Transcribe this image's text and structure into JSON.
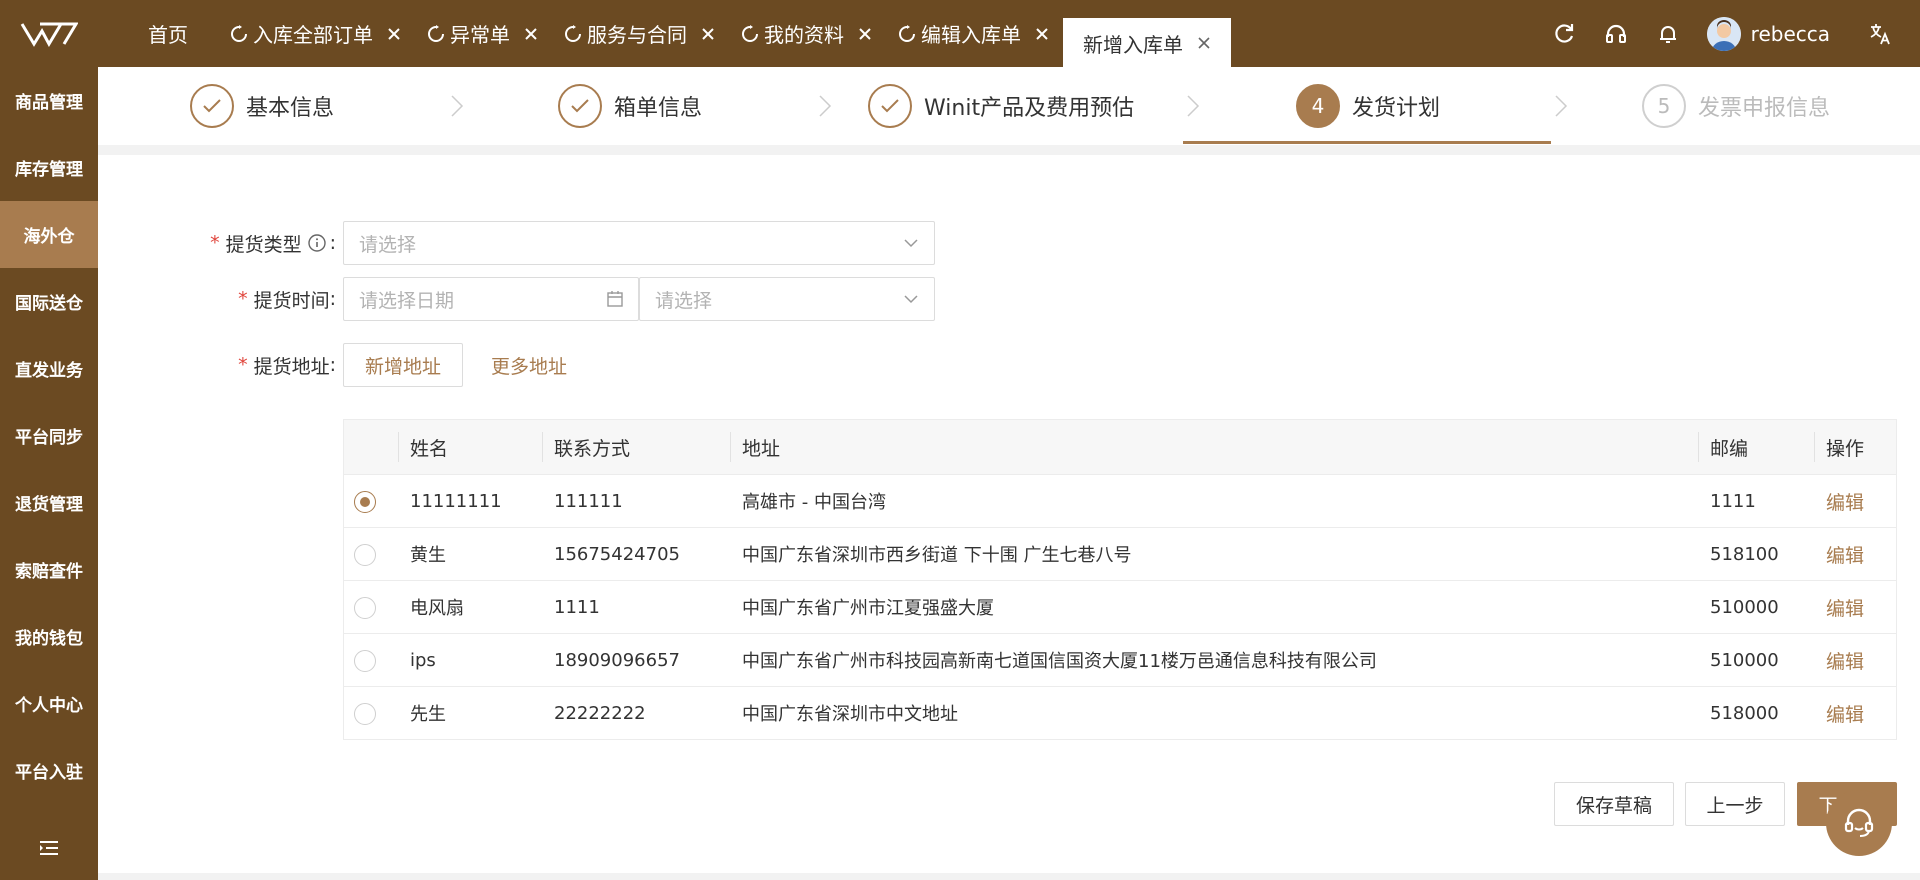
{
  "app": {
    "tabs": [
      {
        "label": "首页"
      },
      {
        "label": "入库全部订单"
      },
      {
        "label": "异常单"
      },
      {
        "label": "服务与合同"
      },
      {
        "label": "我的资料"
      },
      {
        "label": "编辑入库单"
      },
      {
        "label": "新增入库单"
      }
    ],
    "username": "rebecca"
  },
  "sidebar": {
    "items": [
      {
        "label": "商品管理"
      },
      {
        "label": "库存管理"
      },
      {
        "label": "海外仓"
      },
      {
        "label": "国际送仓"
      },
      {
        "label": "直发业务"
      },
      {
        "label": "平台同步"
      },
      {
        "label": "退货管理"
      },
      {
        "label": "索赔查件"
      },
      {
        "label": "我的钱包"
      },
      {
        "label": "个人中心"
      },
      {
        "label": "平台入驻"
      }
    ],
    "active_index": 2
  },
  "steps": [
    {
      "label": "基本信息",
      "status": "done"
    },
    {
      "label": "箱单信息",
      "status": "done"
    },
    {
      "label": "Winit产品及费用预估",
      "status": "done"
    },
    {
      "label": "发货计划",
      "number": "4",
      "status": "current"
    },
    {
      "label": "发票申报信息",
      "number": "5",
      "status": "future"
    }
  ],
  "form": {
    "pickup_type": {
      "label": "提货类型",
      "placeholder": "请选择"
    },
    "pickup_time": {
      "label": "提货时间",
      "date_placeholder": "请选择日期",
      "slot_placeholder": "请选择"
    },
    "pickup_address": {
      "label": "提货地址",
      "add_button": "新增地址",
      "more_link": "更多地址"
    },
    "colon": ":"
  },
  "table": {
    "headers": {
      "name": "姓名",
      "phone": "联系方式",
      "address": "地址",
      "zip": "邮编",
      "action": "操作"
    },
    "rows": [
      {
        "name": "11111111",
        "phone": "111111",
        "address": "高雄市 - 中国台湾",
        "zip": "1111",
        "action": "编辑",
        "selected": true
      },
      {
        "name": "黄生",
        "phone": "15675424705",
        "address": "中国广东省深圳市西乡街道 下十围 广生七巷八号",
        "zip": "518100",
        "action": "编辑",
        "selected": false
      },
      {
        "name": "电风扇",
        "phone": "1111",
        "address": "中国广东省广州市江夏强盛大厦",
        "zip": "510000",
        "action": "编辑",
        "selected": false
      },
      {
        "name": "ips",
        "phone": "18909096657",
        "address": "中国广东省广州市科技园高新南七道国信国资大厦11楼万邑通信息科技有限公司",
        "zip": "510000",
        "action": "编辑",
        "selected": false
      },
      {
        "name": "先生",
        "phone": "22222222",
        "address": "中国广东省深圳市中文地址",
        "zip": "518000",
        "action": "编辑",
        "selected": false
      }
    ]
  },
  "footer": {
    "save_draft": "保存草稿",
    "prev": "上一步",
    "next": "下一步"
  },
  "colors": {
    "brand": "#6b4a22",
    "accent": "#a87c4f",
    "required": "#e0453c"
  },
  "icons": [
    "logo-icon",
    "refresh-icon",
    "close-icon",
    "reload-icon",
    "headset-icon",
    "bell-icon",
    "translate-icon",
    "check-icon",
    "chevron-right-icon",
    "info-icon",
    "chevron-down-icon",
    "calendar-icon",
    "menu-collapse-icon",
    "support-icon"
  ]
}
